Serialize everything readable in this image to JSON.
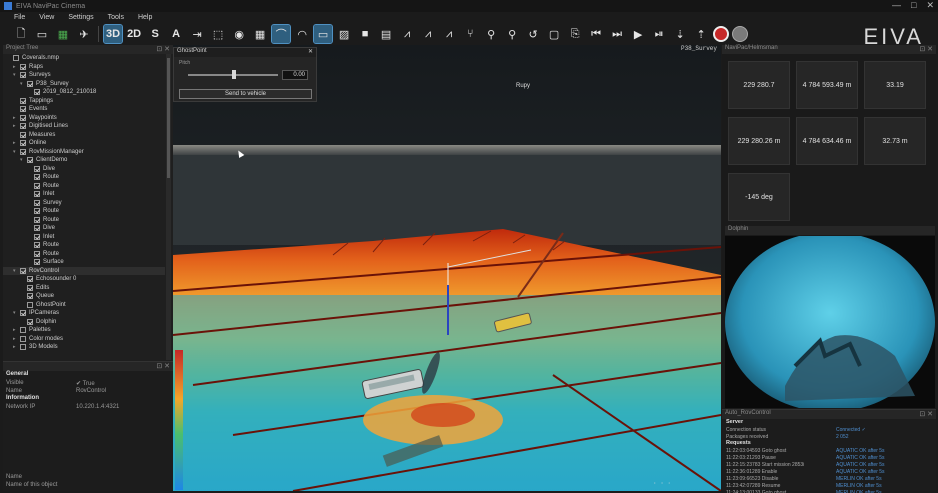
{
  "window": {
    "title": "EIVA NaviPac Cinema",
    "controls": [
      "—",
      "□",
      "✕"
    ]
  },
  "menu": [
    "File",
    "View",
    "Settings",
    "Tools",
    "Help"
  ],
  "toolbar": {
    "mode_3d": "3D",
    "mode_2d": "2D",
    "mode_s": "S",
    "mode_a": "A"
  },
  "brand": "EIVA",
  "left_panel": {
    "title": "Project Tree",
    "tree": [
      {
        "label": "Coverals.nmp",
        "indent": 0,
        "check": false,
        "exp": ""
      },
      {
        "label": "Raps",
        "indent": 1,
        "check": true,
        "exp": "▸"
      },
      {
        "label": "Surveys",
        "indent": 1,
        "check": true,
        "exp": "▾"
      },
      {
        "label": "P38_Survey",
        "indent": 2,
        "check": true,
        "exp": "▾"
      },
      {
        "label": "2019_0812_210018",
        "indent": 3,
        "check": true,
        "exp": ""
      },
      {
        "label": "Tappings",
        "indent": 1,
        "check": true,
        "exp": ""
      },
      {
        "label": "Events",
        "indent": 1,
        "check": true,
        "exp": ""
      },
      {
        "label": "Waypoints",
        "indent": 1,
        "check": true,
        "exp": "▸"
      },
      {
        "label": "Digitised Lines",
        "indent": 1,
        "check": true,
        "exp": "▸"
      },
      {
        "label": "Measures",
        "indent": 1,
        "check": true,
        "exp": ""
      },
      {
        "label": "Online",
        "indent": 1,
        "check": true,
        "exp": "▸"
      },
      {
        "label": "RovMissionManager",
        "indent": 1,
        "check": true,
        "exp": "▾"
      },
      {
        "label": "ClientDemo",
        "indent": 2,
        "check": true,
        "exp": "▾"
      },
      {
        "label": "Dive",
        "indent": 3,
        "check": true,
        "exp": ""
      },
      {
        "label": "Route",
        "indent": 3,
        "check": true,
        "exp": ""
      },
      {
        "label": "Route",
        "indent": 3,
        "check": true,
        "exp": ""
      },
      {
        "label": "Inlet",
        "indent": 3,
        "check": true,
        "exp": ""
      },
      {
        "label": "Survey",
        "indent": 3,
        "check": true,
        "exp": ""
      },
      {
        "label": "Route",
        "indent": 3,
        "check": true,
        "exp": ""
      },
      {
        "label": "Route",
        "indent": 3,
        "check": true,
        "exp": ""
      },
      {
        "label": "Dive",
        "indent": 3,
        "check": true,
        "exp": ""
      },
      {
        "label": "Inlet",
        "indent": 3,
        "check": true,
        "exp": ""
      },
      {
        "label": "Route",
        "indent": 3,
        "check": true,
        "exp": ""
      },
      {
        "label": "Route",
        "indent": 3,
        "check": true,
        "exp": ""
      },
      {
        "label": "Surface",
        "indent": 3,
        "check": true,
        "exp": ""
      },
      {
        "label": "RovControl",
        "indent": 1,
        "check": true,
        "exp": "▾",
        "sel": true
      },
      {
        "label": "Echosounder 0",
        "indent": 2,
        "check": true,
        "exp": ""
      },
      {
        "label": "Edits",
        "indent": 2,
        "check": true,
        "exp": ""
      },
      {
        "label": "Queue",
        "indent": 2,
        "check": true,
        "exp": ""
      },
      {
        "label": "GhostPoint",
        "indent": 2,
        "check": false,
        "exp": ""
      },
      {
        "label": "IPCameras",
        "indent": 1,
        "check": true,
        "exp": "▾"
      },
      {
        "label": "Dolphin",
        "indent": 2,
        "check": true,
        "exp": ""
      },
      {
        "label": "Palettes",
        "indent": 1,
        "check": false,
        "exp": "▸"
      },
      {
        "label": "Color modes",
        "indent": 1,
        "check": false,
        "exp": "▸"
      },
      {
        "label": "3D Models",
        "indent": 1,
        "check": false,
        "exp": "▸"
      }
    ]
  },
  "properties": {
    "general_header": "General",
    "general": [
      {
        "k": "Visible",
        "v": "✔ True"
      },
      {
        "k": "Name",
        "v": "RovControl"
      }
    ],
    "info_header": "Information",
    "info": [
      {
        "k": "Network IP",
        "v": "10.220.1.4:4321"
      }
    ],
    "footer_name": "Name",
    "footer_desc": "Name of this object"
  },
  "ghost_point": {
    "title": "GhostPoint",
    "field_label": "Pitch",
    "value": "0.00",
    "slider_fraction": 0.65,
    "send_label": "Send to vehicle"
  },
  "view": {
    "label": "P38_Survey",
    "tag_top": "Rupy"
  },
  "nav_panel": {
    "title": "NaviPac/Helmsman",
    "cells": [
      {
        "label": "",
        "value": "229 280.7"
      },
      {
        "label": "",
        "value": "4 784 593.49 m"
      },
      {
        "label": "",
        "value": "33.19"
      },
      {
        "label": "",
        "value": "229 280.26 m"
      },
      {
        "label": "",
        "value": "4 784 634.46 m"
      },
      {
        "label": "",
        "value": "32.73 m"
      },
      {
        "label": "",
        "value": "-145 deg"
      }
    ]
  },
  "video_panel": {
    "title": "Dolphin"
  },
  "log_panel": {
    "title": "Auto_RovControl",
    "server_header": "Server",
    "server": [
      {
        "a": "Connection status",
        "b": "Connected ✓"
      },
      {
        "a": "Packages received",
        "b": "2 052"
      }
    ],
    "requests_header": "Requests",
    "requests": [
      {
        "a": "11:22:03:04593 Goto ghost",
        "b": "AQUATIC OK after 5s"
      },
      {
        "a": "11:22:03:21293 Pause",
        "b": "AQUATIC OK after 5s"
      },
      {
        "a": "11:22:15:23783 Start mission 2853i",
        "b": "AQUATIC OK after 5s"
      },
      {
        "a": "11:22:36:01289 Enable",
        "b": "AQUATIC OK after 5s"
      },
      {
        "a": "11:23:09:66523 Disable",
        "b": "MERLIN OK after 5s"
      },
      {
        "a": "11:23:42:07289 Resume",
        "b": "MERLIN OK after 5s"
      },
      {
        "a": "11:24:13:00133 Goto ghost",
        "b": "MERLIN OK after 5s"
      }
    ]
  }
}
